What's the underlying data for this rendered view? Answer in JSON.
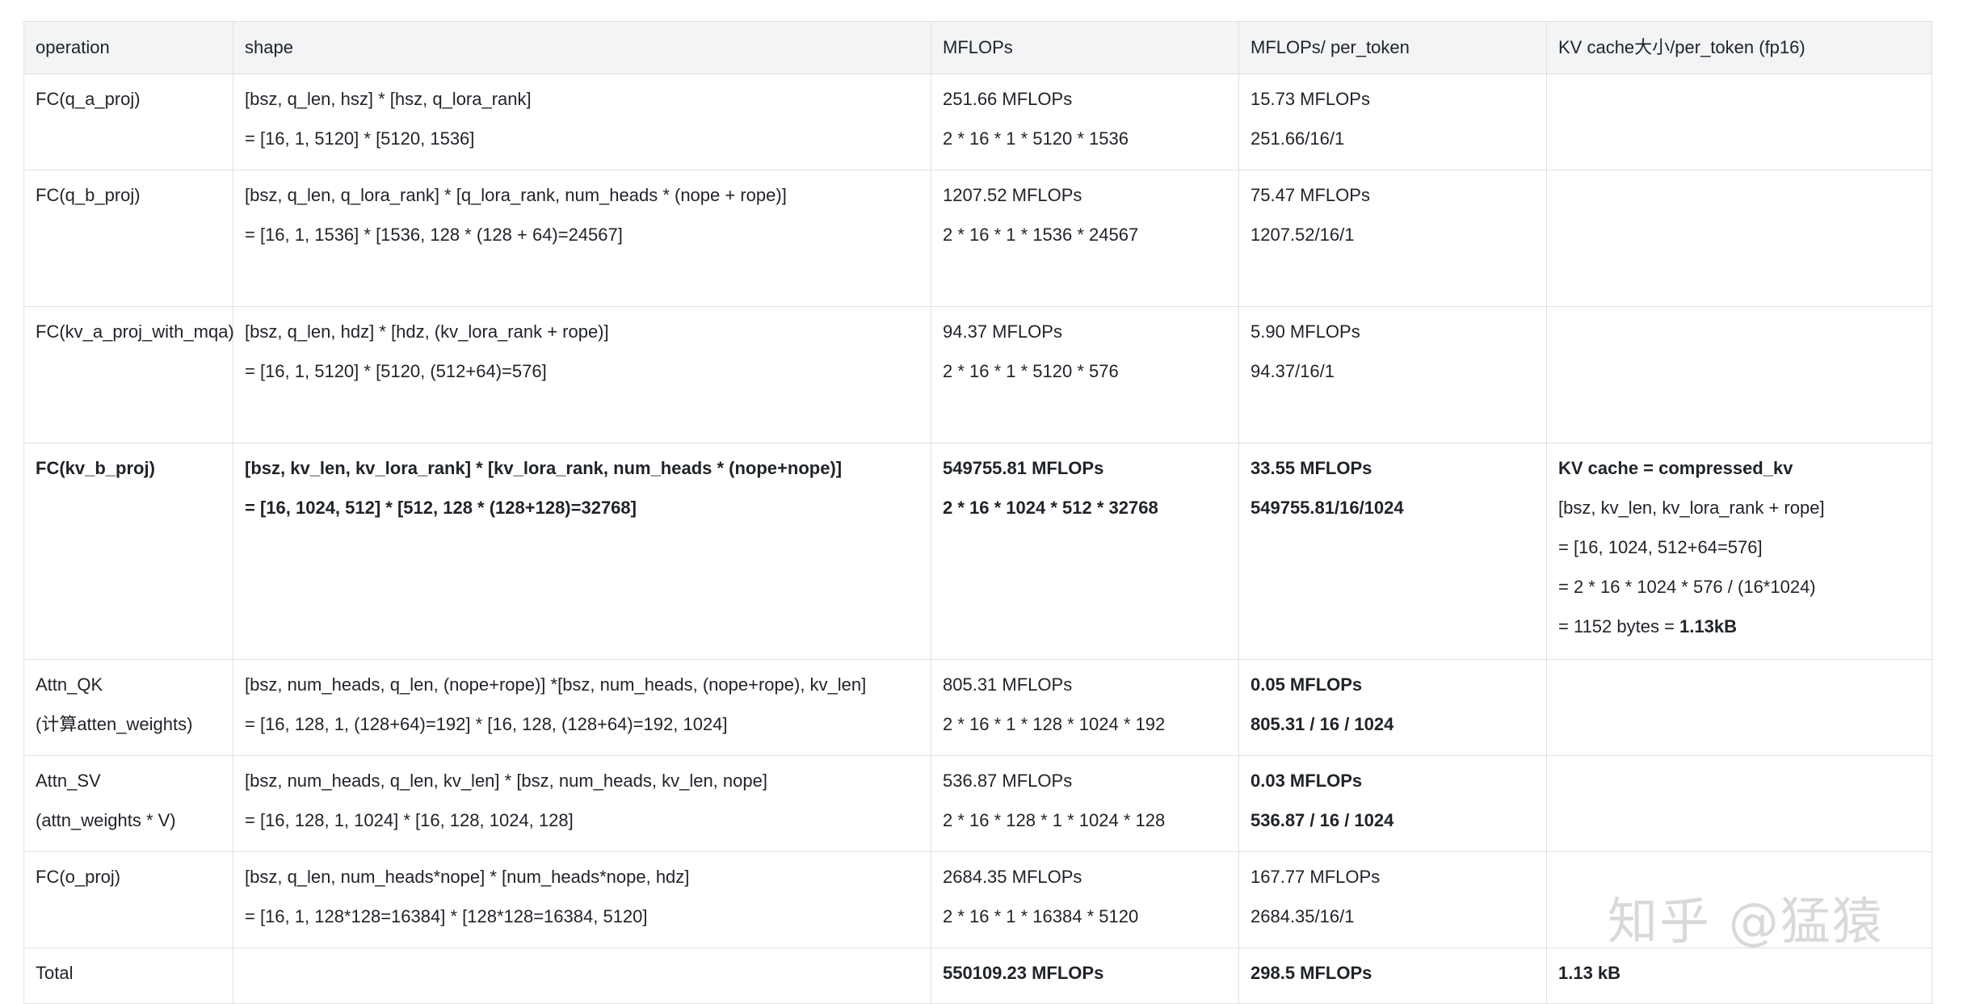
{
  "table": {
    "headers": [
      "operation",
      "shape",
      "MFLOPs",
      "MFLOPs/ per_token",
      "KV cache大小/per_token (fp16)"
    ],
    "rows": [
      {
        "operation": [
          "FC(q_a_proj)"
        ],
        "shape": [
          "[bsz, q_len, hsz] * [hsz, q_lora_rank]",
          "= [16, 1, 5120] * [5120, 1536]"
        ],
        "mflops": [
          "251.66 MFLOPs",
          "2 * 16 * 1 * 5120 * 1536"
        ],
        "per_token": [
          "15.73 MFLOPs",
          "251.66/16/1"
        ],
        "kv_cache": []
      },
      {
        "operation": [
          "FC(q_b_proj)"
        ],
        "shape": [
          "[bsz, q_len, q_lora_rank] * [q_lora_rank, num_heads * (nope + rope)]",
          "= [16, 1, 1536] * [1536, 128 * (128 + 64)=24567]"
        ],
        "mflops": [
          "1207.52 MFLOPs",
          "2 * 16 * 1 * 1536 * 24567"
        ],
        "per_token": [
          "75.47 MFLOPs",
          "1207.52/16/1"
        ],
        "kv_cache": []
      },
      {
        "operation": [
          "FC(kv_a_proj_with_mqa)"
        ],
        "shape": [
          "[bsz, q_len, hdz] * [hdz, (kv_lora_rank + rope)]",
          "= [16, 1, 5120] * [5120, (512+64)=576]"
        ],
        "mflops": [
          "94.37 MFLOPs",
          "2 * 16 * 1 * 5120 * 576"
        ],
        "per_token": [
          "5.90 MFLOPs",
          "94.37/16/1"
        ],
        "kv_cache": []
      },
      {
        "operation": [
          "FC(kv_b_proj)"
        ],
        "shape": [
          "[bsz, kv_len, kv_lora_rank] * [kv_lora_rank, num_heads * (nope+nope)]",
          "= [16, 1024, 512] * [512, 128 * (128+128)=32768]"
        ],
        "mflops": [
          "549755.81 MFLOPs",
          "2 * 16 * 1024 * 512 * 32768"
        ],
        "per_token": [
          "33.55 MFLOPs",
          "549755.81/16/1024"
        ],
        "kv_cache": [
          "KV cache = compressed_kv",
          "[bsz, kv_len, kv_lora_rank + rope]",
          "= [16, 1024, 512+64=576]",
          "= 2 * 16 * 1024 * 576 / (16*1024)",
          "= 1152 bytes = ",
          "1.13kB"
        ]
      },
      {
        "operation": [
          "Attn_QK",
          "(计算atten_weights)"
        ],
        "shape": [
          "[bsz, num_heads, q_len, (nope+rope)] *[bsz, num_heads, (nope+rope), kv_len]",
          "= [16, 128, 1, (128+64)=192] * [16, 128, (128+64)=192, 1024]"
        ],
        "mflops": [
          "805.31 MFLOPs",
          "2 * 16 * 1 * 128 * 1024 * 192"
        ],
        "per_token": [
          "0.05 MFLOPs",
          "805.31 / 16 / 1024"
        ],
        "kv_cache": []
      },
      {
        "operation": [
          "Attn_SV",
          "(attn_weights * V)"
        ],
        "shape": [
          "[bsz, num_heads, q_len, kv_len] * [bsz, num_heads, kv_len, nope]",
          "= [16, 128, 1, 1024] * [16, 128, 1024, 128]"
        ],
        "mflops": [
          "536.87 MFLOPs",
          "2 * 16 * 128 * 1 * 1024 * 128"
        ],
        "per_token": [
          "0.03 MFLOPs",
          "536.87 / 16 / 1024"
        ],
        "kv_cache": []
      },
      {
        "operation": [
          "FC(o_proj)"
        ],
        "shape": [
          "[bsz, q_len, num_heads*nope] * [num_heads*nope, hdz]",
          "= [16, 1, 128*128=16384] * [128*128=16384, 5120]"
        ],
        "mflops": [
          "2684.35 MFLOPs",
          "2 * 16 * 1 * 16384 * 5120"
        ],
        "per_token": [
          "167.77 MFLOPs",
          "2684.35/16/1"
        ],
        "kv_cache": []
      },
      {
        "operation": [
          "Total"
        ],
        "shape": [],
        "mflops": [
          "550109.23 MFLOPs"
        ],
        "per_token": [
          "298.5 MFLOPs"
        ],
        "kv_cache": [
          "1.13 kB"
        ]
      }
    ]
  },
  "watermark": "知乎 @猛猿"
}
